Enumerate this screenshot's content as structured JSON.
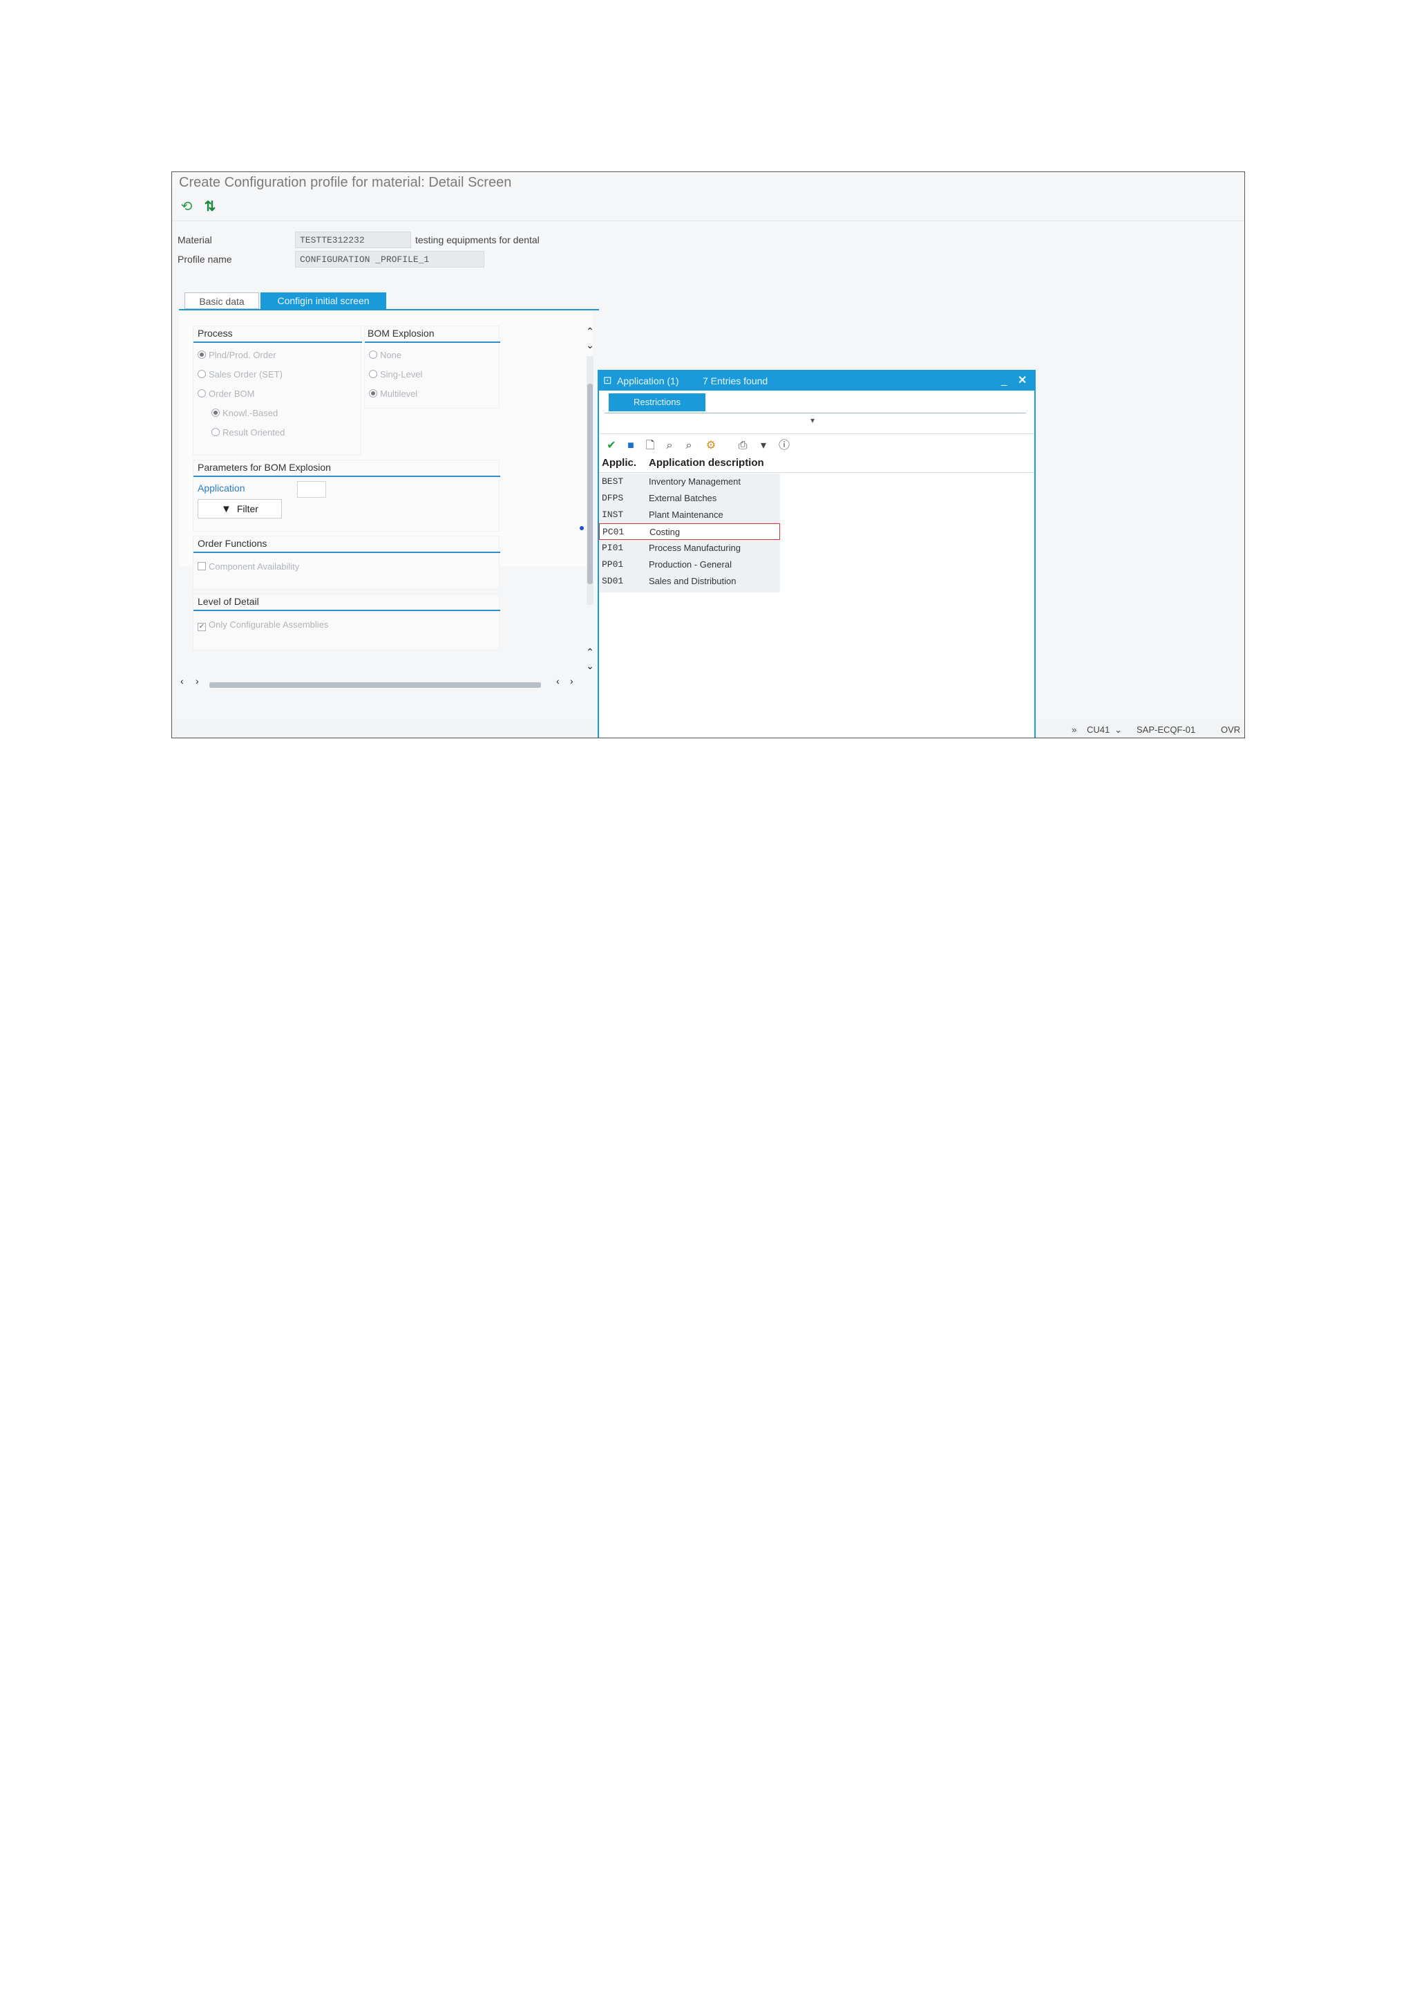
{
  "window": {
    "title": "Create Configuration profile for material: Detail Screen"
  },
  "toolbar": {
    "icons": [
      "refresh-icon",
      "hierarchy-icon"
    ],
    "icon_glyphs": [
      "⟲",
      "⇅"
    ]
  },
  "header": {
    "material_label": "Material",
    "material_value": "TESTTE312232",
    "material_desc": "testing equipments for dental",
    "profile_label": "Profile name",
    "profile_value": "CONFIGURATION _PROFILE_1"
  },
  "tabs": [
    {
      "label": "Basic data",
      "active": false
    },
    {
      "label": "Configin initial screen",
      "active": true
    }
  ],
  "process": {
    "title": "Process",
    "options": [
      "Plnd/Prod. Order",
      "Sales Order (SET)",
      "Order BOM"
    ],
    "sub_options": [
      "Knowl.-Based",
      "Result Oriented"
    ]
  },
  "bom_explosion": {
    "title": "BOM Explosion",
    "options": [
      "None",
      "Sing-Level",
      "Multilevel"
    ]
  },
  "params": {
    "title": "Parameters for BOM Explosion",
    "application_label": "Application",
    "filter_label": "Filter"
  },
  "order_functions": {
    "title": "Order Functions",
    "component_label": "Component Availability"
  },
  "level_of_detail": {
    "title": "Level of Detail",
    "assemblies_label": "Only Configurable Assemblies"
  },
  "popup": {
    "title": "Application (1)",
    "entries": "7 Entries found",
    "tab_label": "Restrictions",
    "col_code": "Applic.",
    "col_desc": "Application description",
    "rows": [
      {
        "code": "BEST",
        "desc": "Inventory Management"
      },
      {
        "code": "DFPS",
        "desc": "External Batches"
      },
      {
        "code": "INST",
        "desc": "Plant Maintenance"
      },
      {
        "code": "PC01",
        "desc": "Costing"
      },
      {
        "code": "PI01",
        "desc": "Process Manufacturing"
      },
      {
        "code": "PP01",
        "desc": "Production - General"
      },
      {
        "code": "SD01",
        "desc": "Sales and Distribution"
      }
    ],
    "selected_row": 3
  },
  "status_bar": {
    "transaction": "CU41",
    "system": "SAP-ECQF-01",
    "mode": "OVR"
  },
  "colors": {
    "accent": "#1a9ad8",
    "window_bg": "#f4f6f8",
    "header_line": "#2a8fd0"
  }
}
